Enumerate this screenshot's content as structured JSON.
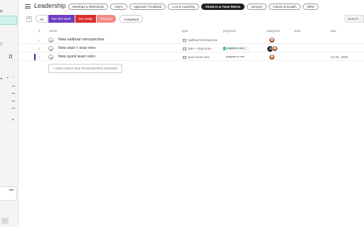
{
  "sidebar": {
    "fragments": [
      "ip",
      "iy",
      "i"
    ],
    "card_dots": "•••",
    "bottom_button": "..."
  },
  "header": {
    "title": "Leadership",
    "tabs": [
      {
        "label": "Meetings & Workshops",
        "active": false
      },
      {
        "label": "Async",
        "active": false
      },
      {
        "label": "Approval / Feedback",
        "active": false
      },
      {
        "label": "1:1s & Coaching",
        "active": false
      },
      {
        "label": "Check-in & Team Retros",
        "active": true
      },
      {
        "label": "Surveys",
        "active": false
      },
      {
        "label": "Culture & Growth",
        "active": false
      },
      {
        "label": "Other",
        "active": false
      }
    ]
  },
  "filters": {
    "add_label": "+",
    "all": "All",
    "due_this_week": "Due this week",
    "due_today": "Due today",
    "past_due": "Past due",
    "completed": "Completed",
    "search_placeholder": "Search..."
  },
  "table": {
    "columns": {
      "num": "#",
      "name": "name",
      "type": "type",
      "progress": "progress",
      "assigned": "assigned",
      "start": "start",
      "due": "due"
    },
    "rows": [
      {
        "num": "1",
        "name": "New sailboat retrospective",
        "type": "Sailboat Retrospective",
        "progress": "",
        "assigned_badge": "",
        "start": "",
        "due": ""
      },
      {
        "num": "2",
        "name": "New start + stop retro",
        "type": "Start + Stop Retro",
        "progress": "progress to com",
        "assigned_badge": "2",
        "start": "",
        "due": ""
      },
      {
        "num": "3",
        "name": "New quick team retro",
        "type": "Quick team retro",
        "progress": "progress to com",
        "assigned_badge": "",
        "start": "",
        "due": "Jul 21, 2023"
      }
    ],
    "add_session_label": "+ ADD CHECK-IN & TEAM RETROS SESSION"
  },
  "colors": {
    "due_this_week": "#6c3ec2",
    "due_today": "#d9302c",
    "past_due": "#f28b83",
    "active_tab": "#1f1f1f",
    "progress_fill": "#2bbd9e",
    "sidebar_highlight": "#cff1ea"
  }
}
